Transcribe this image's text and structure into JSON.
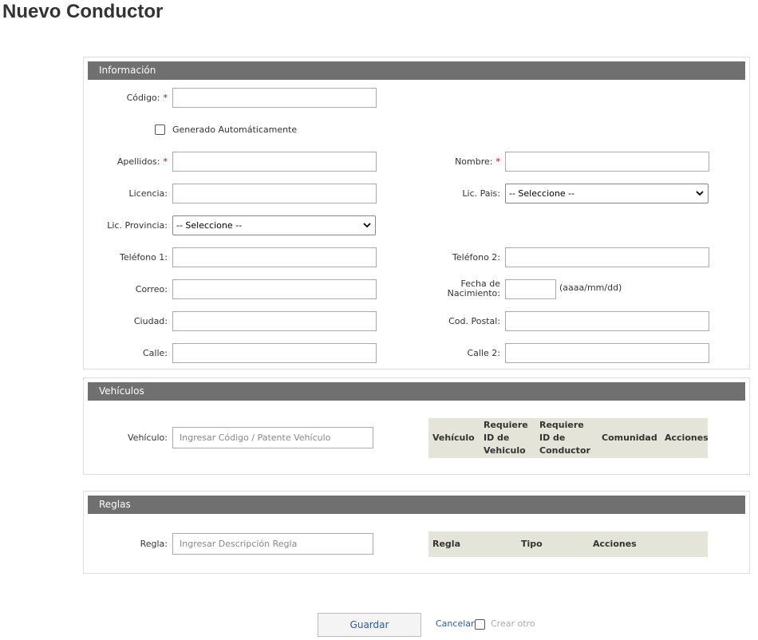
{
  "page": {
    "title": "Nuevo Conductor"
  },
  "info": {
    "header": "Información",
    "codigo_label": "Código:",
    "required_mark": "*",
    "auto_label": "Generado Automáticamente",
    "apellidos_label": "Apellidos:",
    "nombre_label": "Nombre:",
    "licencia_label": "Licencia:",
    "lic_pais_label": "Lic. Pais:",
    "lic_pais_value": "-- Seleccione --",
    "lic_provincia_label": "Lic. Provincia:",
    "lic_provincia_value": "-- Seleccione --",
    "telefono1_label": "Teléfono 1:",
    "telefono2_label": "Teléfono 2:",
    "correo_label": "Correo:",
    "fecha_label_1": "Fecha de",
    "fecha_label_2": "Nacimiento:",
    "fecha_hint": "(aaaa/mm/dd)",
    "ciudad_label": "Ciudad:",
    "cod_postal_label": "Cod. Postal:",
    "calle_label": "Calle:",
    "calle2_label": "Calle 2:"
  },
  "vehiculos": {
    "header": "Vehículos",
    "vehiculo_label": "Vehículo:",
    "vehiculo_placeholder": "Ingresar Código / Patente Vehículo",
    "columns": [
      "Vehículo",
      "Requiere",
      "ID de",
      "Vehiculo",
      "Requiere",
      "ID de",
      "Conductor",
      "Comunidad",
      "Acciones"
    ]
  },
  "reglas": {
    "header": "Reglas",
    "regla_label": "Regla:",
    "regla_placeholder": "Ingresar Descripción Regla",
    "columns": [
      "Regla",
      "Tipo",
      "Acciones"
    ]
  },
  "actions": {
    "save_label": "Guardar",
    "cancel_label": "Cancelar",
    "create_another_label": "Crear otro"
  },
  "colors": {
    "section_header": "#707070",
    "grid_header": "#e4e4d8",
    "link": "#2a5b9a",
    "required": "#cc0000"
  }
}
